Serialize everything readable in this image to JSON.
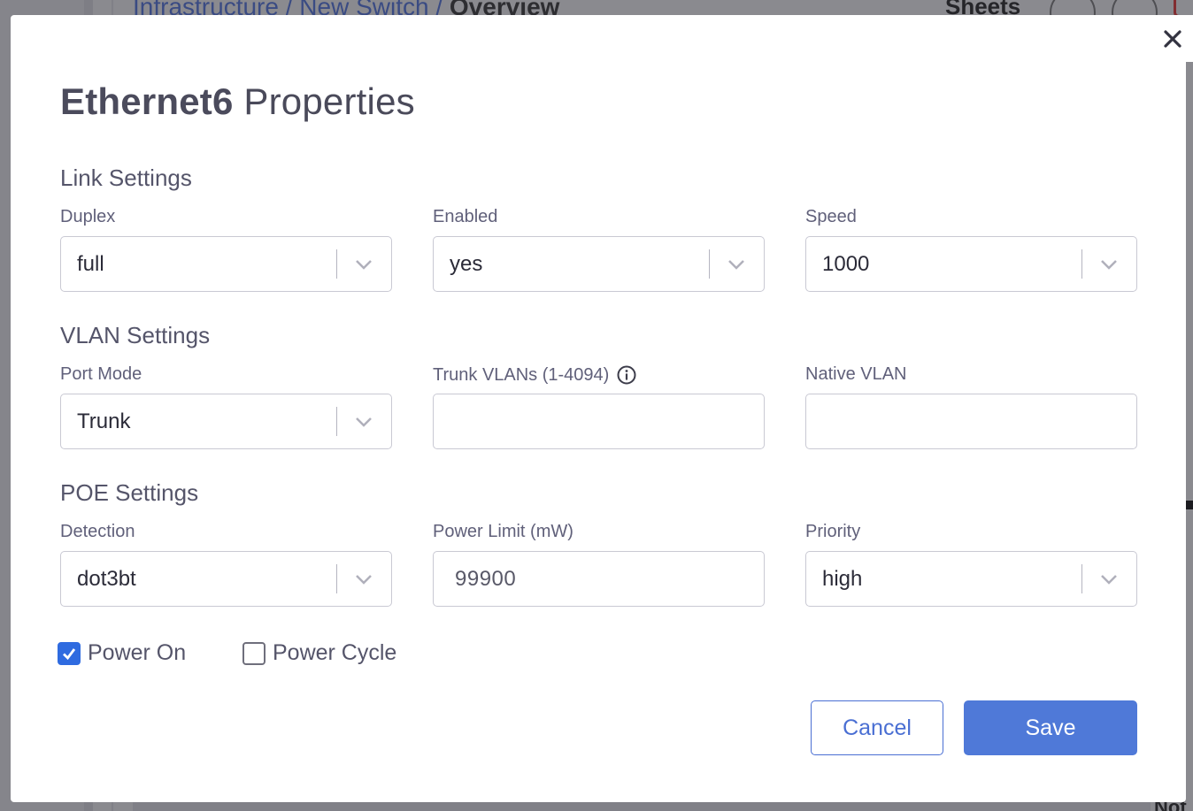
{
  "background": {
    "breadcrumb": {
      "segment1": "Infrastructure",
      "separator": " / ",
      "segment2": "New Switch",
      "current": "Overview"
    },
    "header_right_label": "Sheets",
    "bottom_text": "Not"
  },
  "modal": {
    "title_bold": "Ethernet6",
    "title_rest": "Properties",
    "close_icon": "close-icon",
    "link_settings": {
      "heading": "Link Settings",
      "duplex": {
        "label": "Duplex",
        "value": "full"
      },
      "enabled": {
        "label": "Enabled",
        "value": "yes"
      },
      "speed": {
        "label": "Speed",
        "value": "1000"
      }
    },
    "vlan_settings": {
      "heading": "VLAN Settings",
      "port_mode": {
        "label": "Port Mode",
        "value": "Trunk"
      },
      "trunk_vlans": {
        "label": "Trunk VLANs (1-4094)",
        "value": "",
        "info_icon": "info-icon"
      },
      "native_vlan": {
        "label": "Native VLAN",
        "value": ""
      }
    },
    "poe_settings": {
      "heading": "POE Settings",
      "detection": {
        "label": "Detection",
        "value": "dot3bt"
      },
      "power_limit": {
        "label": "Power Limit (mW)",
        "value": "99900"
      },
      "priority": {
        "label": "Priority",
        "value": "high"
      }
    },
    "power_on": {
      "label": "Power On",
      "checked": true
    },
    "power_cycle": {
      "label": "Power Cycle",
      "checked": false
    },
    "buttons": {
      "cancel": "Cancel",
      "save": "Save"
    }
  },
  "colors": {
    "accent": "#4f79d8",
    "checkbox": "#2f6be0",
    "overlay": "#8f8f95"
  }
}
